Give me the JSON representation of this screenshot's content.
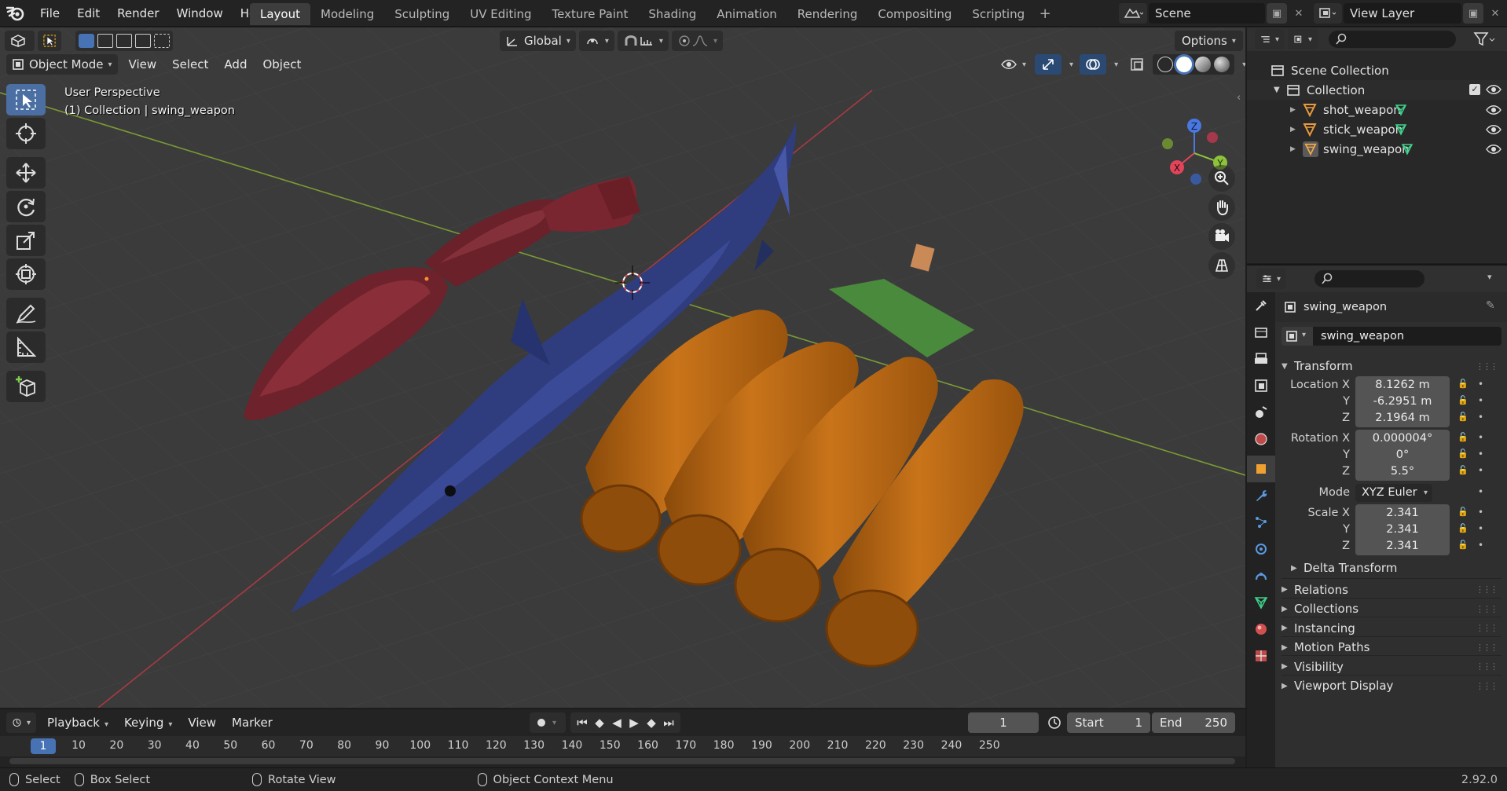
{
  "menu": [
    "File",
    "Edit",
    "Render",
    "Window",
    "Help"
  ],
  "workspaces": [
    "Layout",
    "Modeling",
    "Sculpting",
    "UV Editing",
    "Texture Paint",
    "Shading",
    "Animation",
    "Rendering",
    "Compositing",
    "Scripting"
  ],
  "active_workspace": "Layout",
  "scene": "Scene",
  "view_layer": "View Layer",
  "viewport": {
    "mode": "Object Mode",
    "menus": [
      "View",
      "Select",
      "Add",
      "Object"
    ],
    "orientation": "Global",
    "options": "Options",
    "info_line1": "User Perspective",
    "info_line2": "(1) Collection | swing_weapon",
    "gizmo_labels": {
      "z": "Z",
      "y": "Y",
      "x": "X"
    }
  },
  "outliner": {
    "root": "Scene Collection",
    "collection": "Collection",
    "objects": [
      "shot_weapon",
      "stick_weapon",
      "swing_weapon"
    ]
  },
  "properties": {
    "object_name": "swing_weapon",
    "data_name": "swing_weapon",
    "transform_label": "Transform",
    "location_label": "Location X",
    "location": [
      "8.1262 m",
      "-6.2951 m",
      "2.1964 m"
    ],
    "rotation_label": "Rotation X",
    "rotation": [
      "0.000004°",
      "0°",
      "5.5°"
    ],
    "mode_label": "Mode",
    "mode": "XYZ Euler",
    "scale_label": "Scale X",
    "scale": [
      "2.341",
      "2.341",
      "2.341"
    ],
    "axis_y": "Y",
    "axis_z": "Z",
    "subsections": [
      "Delta Transform"
    ],
    "sections": [
      "Relations",
      "Collections",
      "Instancing",
      "Motion Paths",
      "Visibility",
      "Viewport Display"
    ]
  },
  "timeline": {
    "menus": [
      "Playback",
      "Keying",
      "View",
      "Marker"
    ],
    "current_frame": "1",
    "start_label": "Start",
    "start": "1",
    "end_label": "End",
    "end": "250",
    "ruler": [
      "10",
      "20",
      "30",
      "40",
      "50",
      "60",
      "70",
      "80",
      "90",
      "100",
      "110",
      "120",
      "130",
      "140",
      "150",
      "160",
      "170",
      "180",
      "190",
      "200",
      "210",
      "220",
      "230",
      "240",
      "250"
    ],
    "ruler_current": "1"
  },
  "statusbar": {
    "select": "Select",
    "box_select": "Box Select",
    "rotate_view": "Rotate View",
    "context_menu": "Object Context Menu",
    "version": "2.92.0"
  },
  "colors": {
    "stick_weapon": "#7a2630",
    "shot_weapon": "#2f3d7e",
    "swing_weapon_barrels": "#b8650f",
    "swing_weapon_plate": "#4a8a3c",
    "handle": "#c98a57",
    "accent": "#4772b3"
  }
}
